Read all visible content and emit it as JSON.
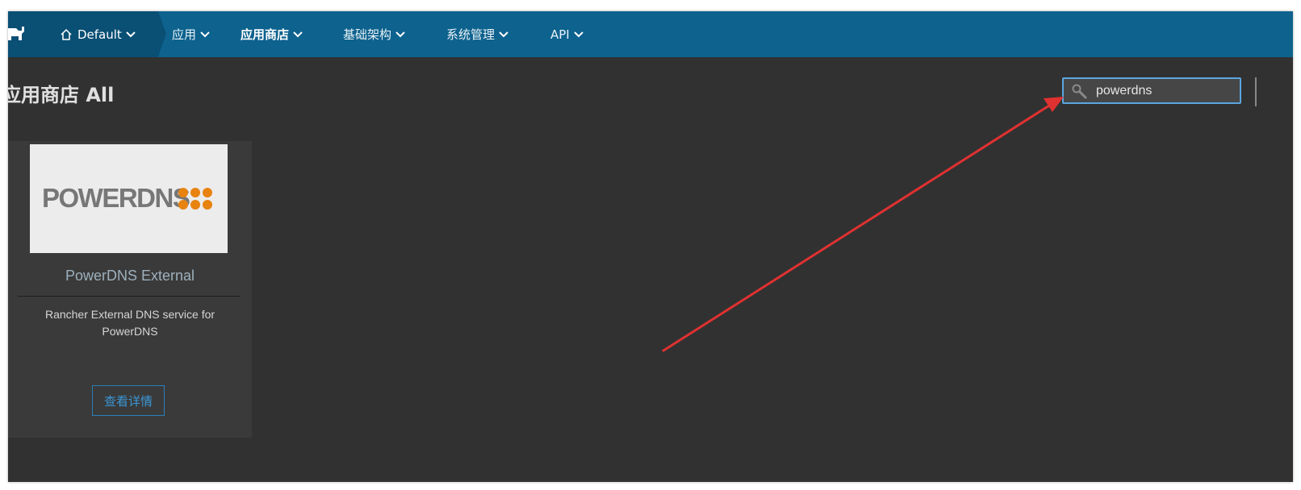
{
  "header": {
    "environment": "Default",
    "menu": [
      {
        "label": "应用",
        "active": false
      },
      {
        "label": "应用商店",
        "active": true
      },
      {
        "label": "基础架构",
        "active": false
      },
      {
        "label": "系统管理",
        "active": false
      },
      {
        "label": "API",
        "active": false
      }
    ]
  },
  "page": {
    "title": "应用商店 All"
  },
  "search": {
    "value": "powerdns",
    "icon": "search-icon"
  },
  "catalog": {
    "items": [
      {
        "logo_text": "POWERDNS",
        "title": "PowerDNS External",
        "description": "Rancher External DNS service for PowerDNS",
        "button": "查看详情"
      }
    ]
  },
  "colors": {
    "nav": "#0d628e",
    "nav_dark": "#0a4f74",
    "background": "#313131",
    "card": "#3a3a3a",
    "accent": "#3a97d6",
    "annotation_arrow": "#e03131",
    "powerdns_orange": "#e8830f"
  }
}
